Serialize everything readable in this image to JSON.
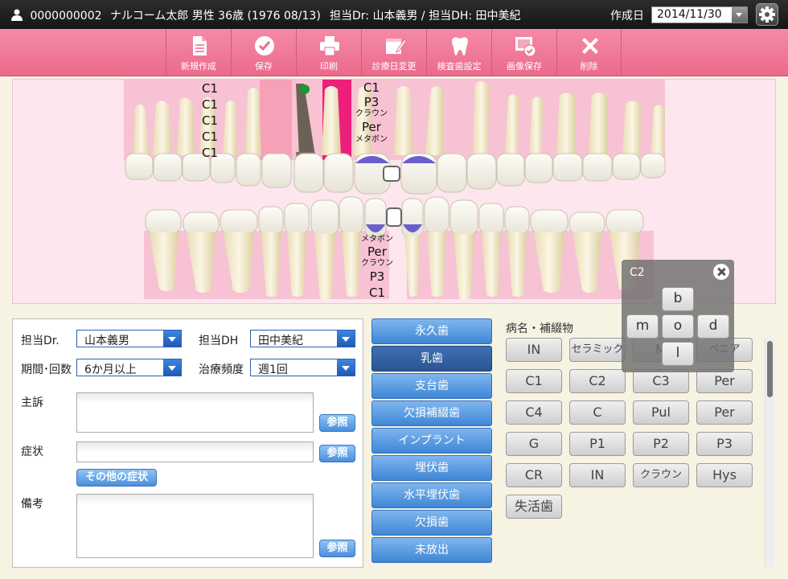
{
  "header": {
    "patient_id": "0000000002",
    "patient_info": "ナルコーム太郎 男性 36歳 (1976 08/13)",
    "staff_info": "担当Dr: 山本義男 / 担当DH: 田中美紀",
    "created_label": "作成日",
    "created_date": "2014/11/30"
  },
  "toolbar": {
    "new": "新規作成",
    "save": "保存",
    "print": "印刷",
    "change_date": "診療日変更",
    "exam_tooth": "検査歯設定",
    "save_image": "画像保存",
    "delete": "削除"
  },
  "chart_labels": {
    "upper_left": [
      "C1",
      "C1",
      "C1",
      "C1",
      "C1"
    ],
    "upper_center": {
      "c1": "C1",
      "p3": "P3",
      "crown": "クラウン",
      "per": "Per",
      "metabond": "メタボン"
    },
    "lower_center": {
      "metabond": "メタボン",
      "per": "Per",
      "crown": "クラウン",
      "p3": "P3",
      "c1": "C1"
    }
  },
  "form": {
    "dr_label": "担当Dr.",
    "dr_value": "山本義男",
    "dh_label": "担当DH",
    "dh_value": "田中美紀",
    "period_label": "期間･回数",
    "period_value": "6か月以上",
    "freq_label": "治療頻度",
    "freq_value": "週1回",
    "complaint_label": "主訴",
    "symptom_label": "症状",
    "other_symptom": "その他の症状",
    "memo_label": "備考",
    "ref": "参照"
  },
  "categories": {
    "items": [
      "永久歯",
      "乳歯",
      "支台歯",
      "欠損補綴歯",
      "インプラント",
      "埋伏歯",
      "水平埋伏歯",
      "欠損歯",
      "未放出"
    ],
    "active": "乳歯"
  },
  "diagnosis": {
    "title": "病名・補綴物",
    "rows": [
      [
        "IN",
        "セラミック",
        "M",
        "ベニア"
      ],
      [
        "C1",
        "C2",
        "C3",
        "Per"
      ],
      [
        "C4",
        "C",
        "Pul",
        "Per"
      ],
      [
        "G",
        "P1",
        "P2",
        "P3"
      ],
      [
        "CR",
        "IN",
        "クラウン",
        "Hys"
      ],
      [
        "失活歯"
      ]
    ]
  },
  "popup": {
    "title": "C2",
    "b": "b",
    "m": "m",
    "o": "o",
    "d": "d",
    "l": "l"
  }
}
